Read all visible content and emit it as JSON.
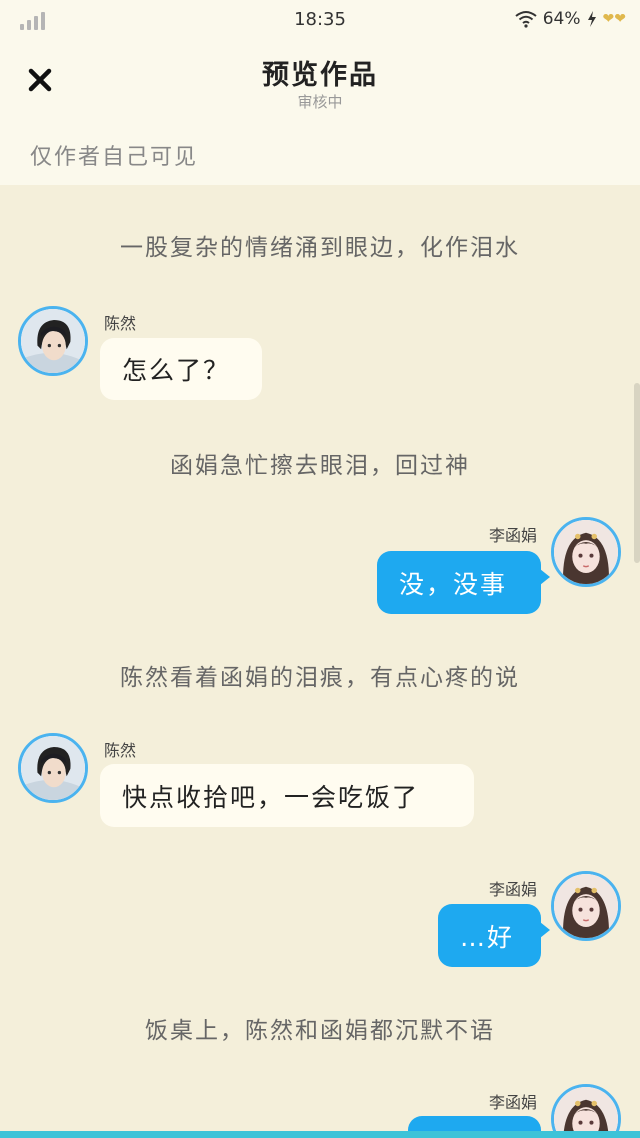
{
  "status": {
    "time": "18:35",
    "battery": "64%",
    "hearts": "❤❤"
  },
  "header": {
    "title": "预览作品",
    "subtitle": "审核中",
    "visibility": "仅作者自己可见"
  },
  "chat": [
    {
      "type": "narration",
      "text": "一股复杂的情绪涌到眼边，化作泪水"
    },
    {
      "type": "message",
      "side": "left",
      "name": "陈然",
      "text": "怎么了？"
    },
    {
      "type": "narration",
      "text": "函娟急忙擦去眼泪，回过神"
    },
    {
      "type": "message",
      "side": "right",
      "name": "李函娟",
      "text": "没，没事"
    },
    {
      "type": "narration",
      "text": "陈然看着函娟的泪痕，有点心疼的说"
    },
    {
      "type": "message",
      "side": "left",
      "name": "陈然",
      "text": "快点收拾吧，一会吃饭了"
    },
    {
      "type": "message",
      "side": "right",
      "name": "李函娟",
      "text": "…好"
    },
    {
      "type": "narration",
      "text": "饭桌上，陈然和函娟都沉默不语"
    },
    {
      "type": "message",
      "side": "right",
      "name": "李函娟",
      "text": ""
    }
  ]
}
